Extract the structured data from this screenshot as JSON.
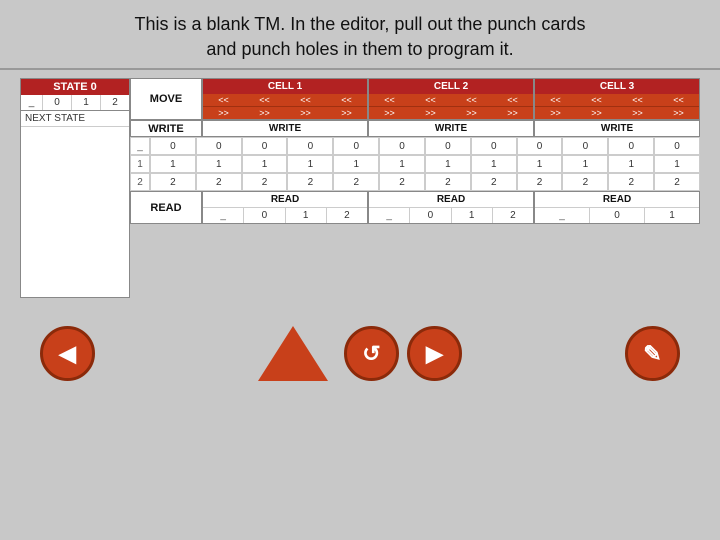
{
  "header": {
    "line1": "This is a blank TM.  In the editor, pull out the punch cards",
    "line2": "and punch holes in them to program it."
  },
  "state_panel": {
    "title": "STATE 0",
    "cols": [
      "_",
      "0",
      "1",
      "2"
    ],
    "next_state_label": "NEXT STATE"
  },
  "labels": {
    "move": "MOVE",
    "write": "WRITE",
    "read": "READ"
  },
  "cells": [
    {
      "id": "cell1",
      "header": "CELL 1",
      "arrow_row1": [
        "<<",
        "<<",
        "<<",
        "<<"
      ],
      "arrow_row2": [
        ">>",
        ">>",
        ">>",
        ">>"
      ],
      "write_label": "WRITE",
      "rows": [
        {
          "label": "_",
          "vals": [
            "0",
            "0",
            "0",
            "0"
          ]
        },
        {
          "label": "1",
          "vals": [
            "1",
            "1",
            "1",
            "1"
          ]
        },
        {
          "label": "2",
          "vals": [
            "2",
            "2",
            "2",
            "2"
          ]
        }
      ],
      "read_label": "READ",
      "read_cols": [
        "_",
        "0",
        "1",
        "2"
      ]
    },
    {
      "id": "cell2",
      "header": "CELL 2",
      "arrow_row1": [
        "<<",
        "<<",
        "<<",
        "<<"
      ],
      "arrow_row2": [
        ">>",
        ">>",
        ">>",
        ">>"
      ],
      "write_label": "WRITE",
      "rows": [
        {
          "label": "_",
          "vals": [
            "0",
            "0",
            "0",
            "0"
          ]
        },
        {
          "label": "1",
          "vals": [
            "1",
            "1",
            "1",
            "1"
          ]
        },
        {
          "label": "2",
          "vals": [
            "2",
            "2",
            "2",
            "2"
          ]
        }
      ],
      "read_label": "READ",
      "read_cols": [
        "_",
        "0",
        "1",
        "2"
      ]
    },
    {
      "id": "cell3",
      "header": "CELL 3",
      "arrow_row1": [
        "<<",
        "<<",
        "<<",
        "<<"
      ],
      "arrow_row2": [
        ">>",
        ">>",
        ">>",
        ">>"
      ],
      "write_label": "WRITE",
      "rows": [
        {
          "label": "_",
          "vals": [
            "0",
            "0",
            "0",
            "0"
          ]
        },
        {
          "label": "1",
          "vals": [
            "1",
            "1",
            "1",
            "1"
          ]
        },
        {
          "label": "2",
          "vals": [
            "2",
            "2",
            "2",
            "2"
          ]
        }
      ],
      "read_label": "READ",
      "read_cols": [
        "_",
        "0",
        "1"
      ]
    }
  ],
  "buttons": {
    "back_icon": "◀",
    "reset_icon": "↺",
    "play_icon": "▶",
    "pencil_icon": "✎"
  },
  "colors": {
    "accent": "#c8401a",
    "cell_header": "#b22222",
    "bg": "#c8c8c8",
    "panel_bg": "white"
  }
}
